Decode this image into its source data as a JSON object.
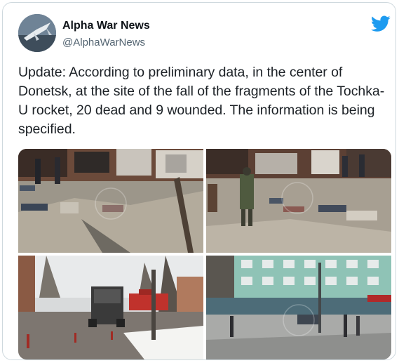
{
  "tweet": {
    "display_name": "Alpha War News",
    "handle": "@AlphaWarNews",
    "text": "Update: According to preliminary data, in the center of Donetsk, at the site of the fall of the fragments of the Tochka-U rocket, 20 dead and 9 wounded. The information is being specified."
  },
  "icons": {
    "platform": "twitter-bird-icon"
  },
  "colors": {
    "brand": "#1d9bf0",
    "border": "#cfd9de",
    "secondary_text": "#536471"
  },
  "media": {
    "photo_count": 4
  }
}
